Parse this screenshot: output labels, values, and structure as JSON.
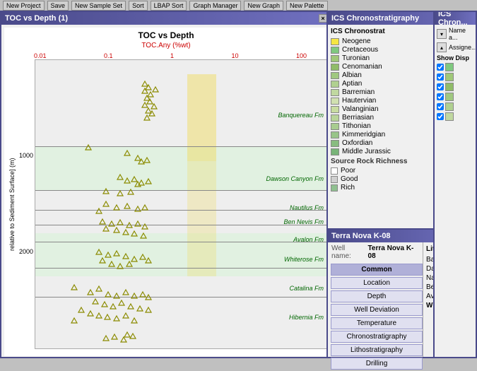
{
  "topbar": {
    "buttons": [
      "New Project",
      "Save",
      "New Sample Set",
      "Sort",
      "LBAP Sort",
      "Graph Manager",
      "New Graph",
      "New Palette"
    ]
  },
  "toc_window": {
    "title": "TOC vs Depth (1)",
    "chart_title": "TOC vs Depth",
    "x_axis_label": "TOC.Any (%wt)",
    "y_axis_label": "relative to Sediment Surface] (m)",
    "x_ticks": [
      "0.01",
      "0.1",
      "1",
      "10",
      "100"
    ],
    "formations": [
      {
        "label": "Banquereau Fm",
        "y_pct": 20
      },
      {
        "label": "Dawson Canyon Fm",
        "y_pct": 42
      },
      {
        "label": "Nautilus Fm",
        "y_pct": 53
      },
      {
        "label": "Ben Nevis Fm",
        "y_pct": 57
      },
      {
        "label": "Avalon Fm",
        "y_pct": 63
      },
      {
        "label": "Whiterose Fm",
        "y_pct": 70
      },
      {
        "label": "Catalina Fm",
        "y_pct": 80
      },
      {
        "label": "Hibernia Fm",
        "y_pct": 90
      }
    ],
    "y_ticks": [
      "1000",
      "2000"
    ],
    "depth_label_1000": "1000",
    "depth_label_2000": "2000"
  },
  "ics_window": {
    "title": "ICS Chronostratigraphy",
    "legend_title": "ICS Chronostrat",
    "items": [
      {
        "label": "Neogene",
        "color": "#f5e642"
      },
      {
        "label": "Cretaceous",
        "color": "#7fc97f"
      },
      {
        "label": "Turonian",
        "color": "#a0c878"
      },
      {
        "label": "Cenomanian",
        "color": "#90bc68"
      },
      {
        "label": "Albian",
        "color": "#a0c880"
      },
      {
        "label": "Aptian",
        "color": "#b0d090"
      },
      {
        "label": "Barremian",
        "color": "#c0d8a0"
      },
      {
        "label": "Hautervian",
        "color": "#d0e0b0"
      },
      {
        "label": "Valanginian",
        "color": "#c8dca0"
      },
      {
        "label": "Berriasian",
        "color": "#b8d498"
      },
      {
        "label": "Tithonian",
        "color": "#a8cc90"
      },
      {
        "label": "Kimmeridgian",
        "color": "#98c488"
      },
      {
        "label": "Oxfordian",
        "color": "#88bc80"
      },
      {
        "label": "Middle Jurassic",
        "color": "#78b478"
      }
    ],
    "source_rock_title": "Source Rock Richness",
    "source_rock_items": [
      {
        "label": "Poor",
        "color": "#ffffff"
      },
      {
        "label": "Good",
        "color": "#d0d0d0"
      },
      {
        "label": "Rich",
        "color": "#90c090"
      }
    ]
  },
  "terranova_window": {
    "title": "Terra Nova K-08",
    "well_label": "Well name:",
    "well_name": "Terra Nova K-08",
    "buttons": [
      {
        "label": "Common",
        "active": true
      },
      {
        "label": "Location",
        "active": false
      },
      {
        "label": "Depth",
        "active": false
      },
      {
        "label": "Well Deviation",
        "active": false
      },
      {
        "label": "Temperature",
        "active": false
      },
      {
        "label": "Chronostratigraphy",
        "active": false
      },
      {
        "label": "Lithostratigraphy",
        "active": false
      },
      {
        "label": "Drilling",
        "active": false
      }
    ],
    "litho_title": "Lithostrati...",
    "litho_items": [
      "Banquere...",
      "Dawson C...",
      "Nautilus F...",
      "Ben Nevis...",
      "Avalon Fr...",
      "Whiterose"
    ]
  },
  "right_panel": {
    "title": "ICS Chron...",
    "label1": "Name a...",
    "label2": "Assigne...",
    "show_disp": "Show Disp",
    "items": [
      {
        "color": "#7fc97f"
      },
      {
        "color": "#a0c878"
      },
      {
        "color": "#90bc68"
      },
      {
        "color": "#a0c880"
      },
      {
        "color": "#b0d090"
      },
      {
        "color": "#c0d8a0"
      }
    ]
  }
}
